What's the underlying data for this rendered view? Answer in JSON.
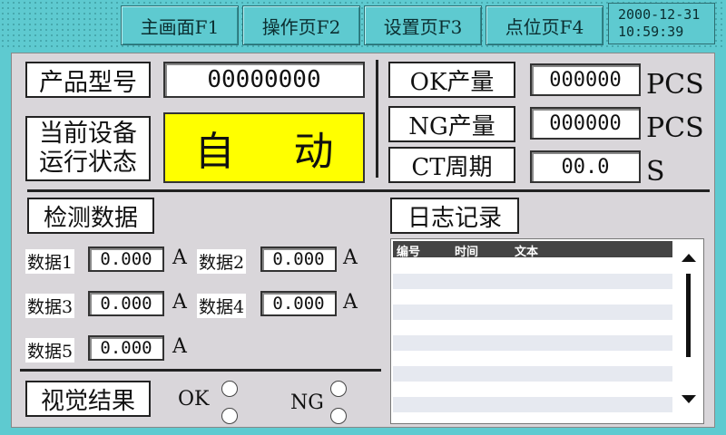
{
  "nav": {
    "items": [
      {
        "label": "主画面F1"
      },
      {
        "label": "操作页F2"
      },
      {
        "label": "设置页F3"
      },
      {
        "label": "点位页F4"
      }
    ],
    "date": "2000-12-31",
    "time": "10:59:39"
  },
  "product": {
    "model_label": "产品型号",
    "model_value": "00000000",
    "state_label_line1": "当前设备",
    "state_label_line2": "运行状态",
    "state_char1": "自",
    "state_char2": "动",
    "state_color": "#ffff00"
  },
  "counters": {
    "ok_label": "OK产量",
    "ok_value": "000000",
    "ok_unit": "PCS",
    "ng_label": "NG产量",
    "ng_value": "000000",
    "ng_unit": "PCS",
    "ct_label": "CT周期",
    "ct_value": "00.0",
    "ct_unit": "S"
  },
  "detection": {
    "title": "检测数据",
    "items": [
      {
        "label": "数据1",
        "value": "0.000",
        "unit": "A"
      },
      {
        "label": "数据2",
        "value": "0.000",
        "unit": "A"
      },
      {
        "label": "数据3",
        "value": "0.000",
        "unit": "A"
      },
      {
        "label": "数据4",
        "value": "0.000",
        "unit": "A"
      },
      {
        "label": "数据5",
        "value": "0.000",
        "unit": "A"
      }
    ]
  },
  "vision": {
    "title": "视觉结果",
    "ok_label": "OK",
    "ng_label": "NG"
  },
  "log": {
    "title": "日志记录",
    "columns": [
      "编号",
      "时间",
      "文本"
    ]
  }
}
